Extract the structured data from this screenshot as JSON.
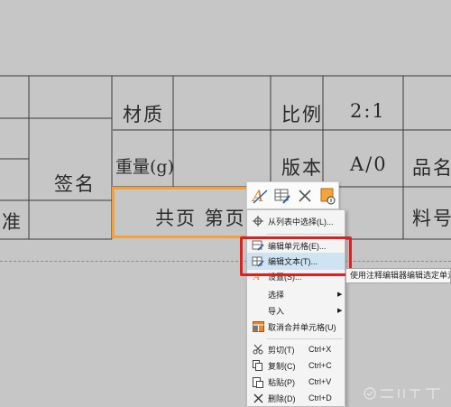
{
  "table": {
    "material_label": "材质",
    "scale_label": "比例",
    "scale_value": "2:1",
    "weight_label": "重量(g)",
    "version_label": "版本",
    "version_value": "A/0",
    "product_name_label": "品名",
    "signature_label": "签名",
    "approve_label_partial": "准",
    "pages_text": "共页 第页",
    "part_number_label": "料号"
  },
  "context_menu": {
    "items": [
      {
        "label": "从列表中选择(L)...",
        "shortcut": "",
        "icon": "crosshair-icon"
      },
      {
        "label": "编辑单元格(E)...",
        "shortcut": "",
        "icon": "edit-cell-icon"
      },
      {
        "label": "编辑文本(T)...",
        "shortcut": "",
        "icon": "edit-text-icon"
      },
      {
        "label": "设置(S)...",
        "shortcut": "",
        "icon": "settings-icon"
      },
      {
        "label": "选择",
        "shortcut": "",
        "icon": ""
      },
      {
        "label": "导入",
        "shortcut": "",
        "icon": ""
      },
      {
        "label": "取消合并单元格(U)",
        "shortcut": "",
        "icon": "unmerge-icon"
      },
      {
        "label": "剪切(T)",
        "shortcut": "Ctrl+X",
        "icon": "scissors-icon"
      },
      {
        "label": "复制(C)",
        "shortcut": "Ctrl+C",
        "icon": "copy-icon"
      },
      {
        "label": "粘贴(P)",
        "shortcut": "Ctrl+V",
        "icon": "paste-icon"
      },
      {
        "label": "删除(D)",
        "shortcut": "Ctrl+D",
        "icon": "delete-icon"
      }
    ]
  },
  "tooltip_text": "使用注释编辑器编辑选定单元格",
  "colors": {
    "selection": "#f3a13f",
    "highlight_box": "#e01f1f",
    "menu_highlight": "#cfe3f3"
  }
}
